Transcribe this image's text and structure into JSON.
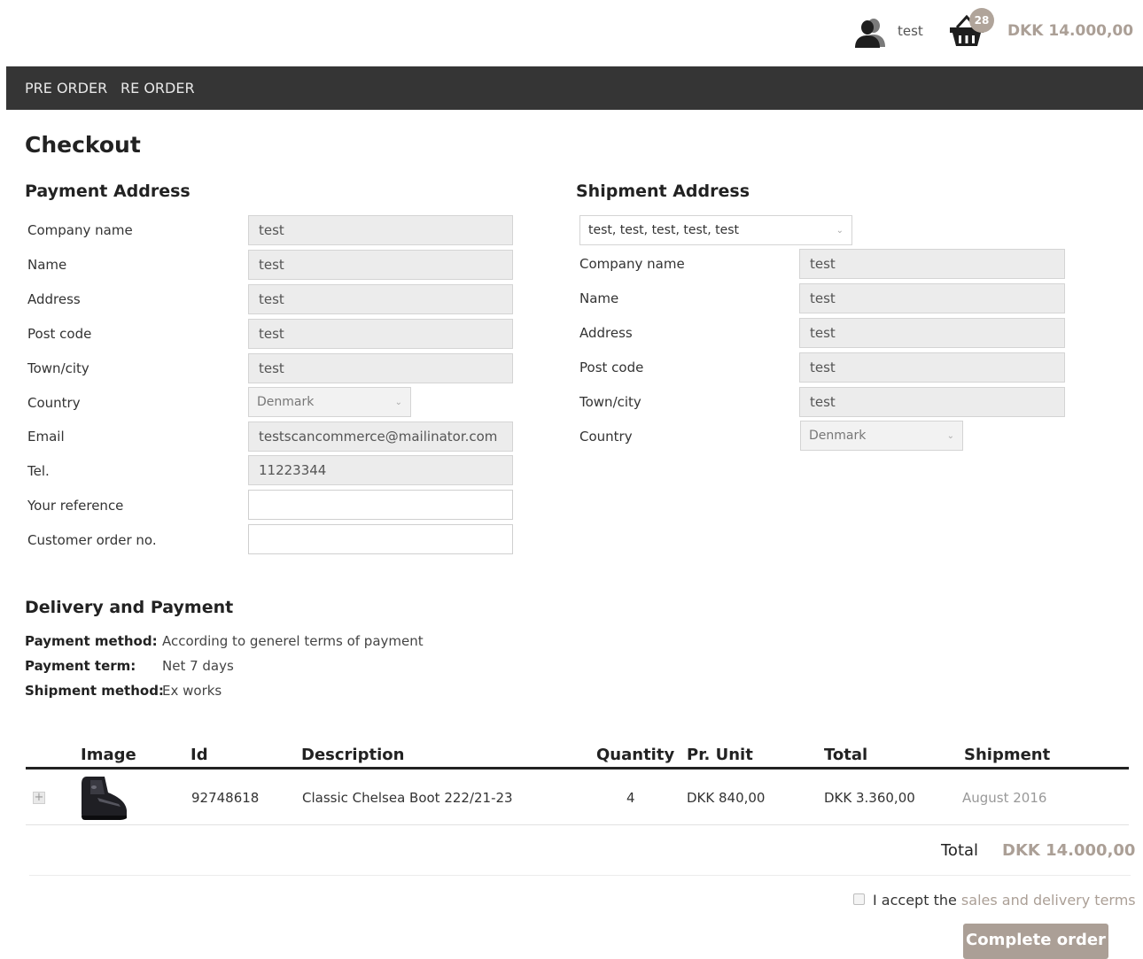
{
  "header": {
    "user_name": "test",
    "cart_count": "28",
    "cart_total": "DKK 14.000,00",
    "user_icon": "user-icon",
    "cart_icon": "basket-icon"
  },
  "nav": {
    "items": [
      "PRE ORDER",
      "RE ORDER"
    ]
  },
  "page_title": "Checkout",
  "payment_address": {
    "heading": "Payment Address",
    "rows": [
      {
        "label": "Company name",
        "value": "test"
      },
      {
        "label": "Name",
        "value": "test"
      },
      {
        "label": "Address",
        "value": "test"
      },
      {
        "label": "Post code",
        "value": "test"
      },
      {
        "label": "Town/city",
        "value": "test"
      },
      {
        "label": "Country",
        "value": "Denmark"
      },
      {
        "label": "Email",
        "value": "testscancommerce@mailinator.com"
      },
      {
        "label": "Tel.",
        "value": "11223344"
      },
      {
        "label": "Your reference",
        "value": ""
      },
      {
        "label": "Customer order no.",
        "value": ""
      }
    ]
  },
  "shipment_address": {
    "heading": "Shipment Address",
    "selected_address": "test, test, test, test, test",
    "rows": [
      {
        "label": "Company name",
        "value": "test"
      },
      {
        "label": "Name",
        "value": "test"
      },
      {
        "label": "Address",
        "value": "test"
      },
      {
        "label": "Post code",
        "value": "test"
      },
      {
        "label": "Town/city",
        "value": "test"
      },
      {
        "label": "Country",
        "value": "Denmark"
      }
    ]
  },
  "delivery": {
    "heading": "Delivery and Payment",
    "payment_method_label": "Payment method:",
    "payment_method": "According to generel terms of payment",
    "payment_term_label": "Payment term:",
    "payment_term": "Net 7 days",
    "shipment_method_label": "Shipment method:",
    "shipment_method": "Ex works"
  },
  "order_table": {
    "columns": [
      "Image",
      "Id",
      "Description",
      "Quantity",
      "Pr. Unit",
      "Total",
      "Shipment"
    ],
    "rows": [
      {
        "id": "92748618",
        "description": "Classic Chelsea Boot 222/21-23",
        "quantity": "4",
        "unit_price": "DKK 840,00",
        "total": "DKK 3.360,00",
        "shipment": "August 2016"
      }
    ],
    "total_label": "Total",
    "total_value": "DKK 14.000,00"
  },
  "terms": {
    "prefix": "I accept the",
    "link": "sales and delivery terms",
    "checked": false
  },
  "complete_button": "Complete order",
  "colors": {
    "accent": "#ab9f96",
    "nav_bg": "#353535"
  }
}
